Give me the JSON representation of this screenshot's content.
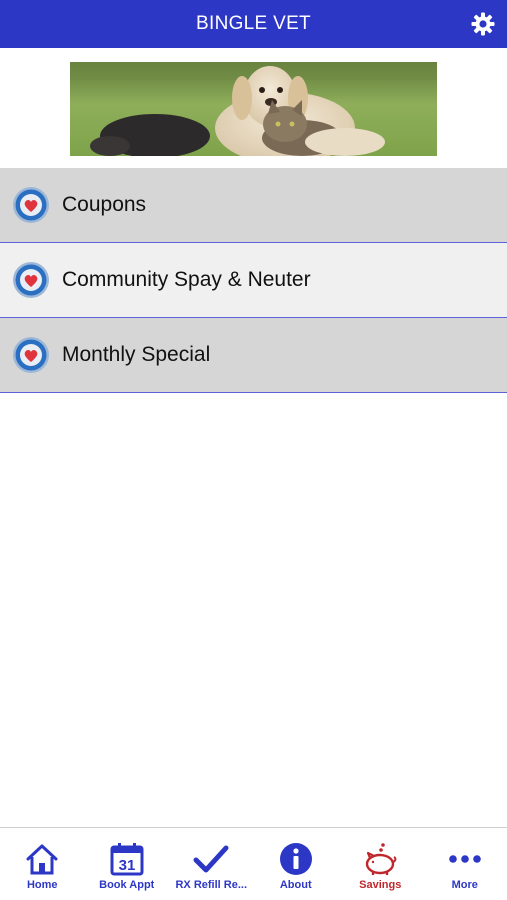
{
  "header": {
    "title": "BINGLE VET"
  },
  "banner": {
    "description": "puppy-and-cat"
  },
  "menu": {
    "items": [
      {
        "label": "Coupons"
      },
      {
        "label": "Community Spay & Neuter"
      },
      {
        "label": "Monthly Special"
      }
    ]
  },
  "tabbar": {
    "items": [
      {
        "label": "Home",
        "icon": "home-icon"
      },
      {
        "label": "Book Appt",
        "icon": "calendar-icon",
        "calendar_day": "31"
      },
      {
        "label": "RX Refill Re...",
        "icon": "checkmark-icon"
      },
      {
        "label": "About",
        "icon": "info-icon"
      },
      {
        "label": "Savings",
        "icon": "piggy-bank-icon"
      },
      {
        "label": "More",
        "icon": "more-icon"
      }
    ]
  },
  "colors": {
    "header_bg": "#2d37c6",
    "accent": "#2d37c6",
    "savings": "#c0272d",
    "divider": "#5b63d6"
  }
}
